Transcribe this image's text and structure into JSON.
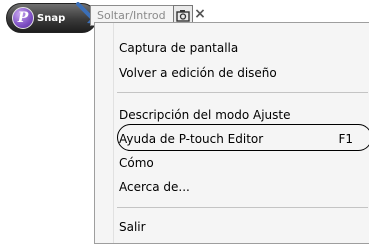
{
  "toolbar": {
    "snap_label": "Snap",
    "logo_letter": "P",
    "combo_text": "Soltar/Introd",
    "close_glyph": "×",
    "icons": [
      "p-touch-logo-icon",
      "snap-arrow-icon",
      "camera-icon",
      "close-icon"
    ]
  },
  "menu": {
    "items": [
      {
        "label": "Captura de pantalla",
        "shortcut": ""
      },
      {
        "label": "Volver a edición de diseño",
        "shortcut": ""
      },
      {
        "label": "Descripción del modo Ajuste",
        "shortcut": ""
      },
      {
        "label": "Ayuda de P-touch Editor",
        "shortcut": "F1"
      },
      {
        "label": "Cómo",
        "shortcut": ""
      },
      {
        "label": "Acerca de...",
        "shortcut": ""
      },
      {
        "label": "Salir",
        "shortcut": ""
      }
    ]
  },
  "colors": {
    "menu_bg": "#f5f5f5",
    "toolbar_bg": "#3a3a3a",
    "logo": "#7e4fc4",
    "arrow": "#3b6fb8"
  }
}
